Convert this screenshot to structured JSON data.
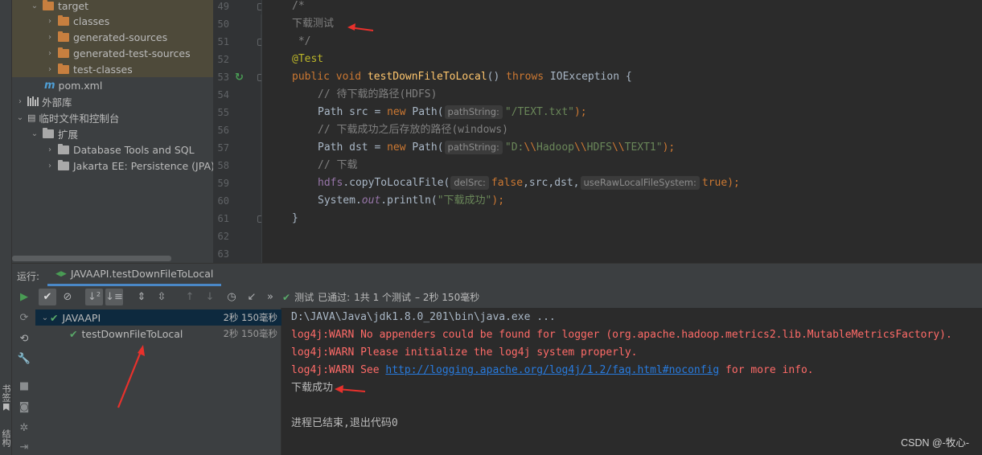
{
  "side_tabs": {
    "bookmarks": "书签",
    "structure": "结构"
  },
  "project_tree": [
    {
      "label": "target",
      "icon": "folder-orange",
      "chevron": "v"
    },
    {
      "label": "classes",
      "icon": "folder-orange",
      "chevron": ">"
    },
    {
      "label": "generated-sources",
      "icon": "folder-orange",
      "chevron": ">"
    },
    {
      "label": "generated-test-sources",
      "icon": "folder-orange",
      "chevron": ">"
    },
    {
      "label": "test-classes",
      "icon": "folder-orange",
      "chevron": ">"
    },
    {
      "label": "pom.xml",
      "icon": "maven-icon",
      "chevron": ""
    },
    {
      "label": "外部库",
      "icon": "library-icon",
      "chevron": ">"
    },
    {
      "label": "临时文件和控制台",
      "icon": "scratch-icon",
      "chevron": "v"
    },
    {
      "label": "扩展",
      "icon": "folder-grey",
      "chevron": "v"
    },
    {
      "label": "Database Tools and SQL",
      "icon": "folder-grey",
      "chevron": ">"
    },
    {
      "label": "Jakarta EE: Persistence (JPA)",
      "icon": "folder-grey",
      "chevron": ">"
    }
  ],
  "line_numbers": [
    "49",
    "50",
    "51",
    "52",
    "53",
    "54",
    "55",
    "56",
    "57",
    "58",
    "59",
    "60",
    "61",
    "62",
    "63"
  ],
  "code": {
    "l49": "/*",
    "l50": "下载测试",
    "l51": " */",
    "l52": "@Test",
    "l53_kw1": "public",
    "l53_kw2": "void",
    "l53_name": "testDownFileToLocal",
    "l53_paren": "() ",
    "l53_throws": "throws",
    "l53_exc": " IOException {",
    "l54": "// 待下载的路径(HDFS)",
    "l55_a": "Path src = ",
    "l55_new": "new",
    "l55_b": " Path(",
    "l55_hint": "pathString:",
    "l55_str": "\"/TEXT.txt\"",
    "l55_end": ");",
    "l56": "// 下载成功之后存放的路径(windows)",
    "l57_a": "Path dst = ",
    "l57_new": "new",
    "l57_b": " Path(",
    "l57_hint": "pathString:",
    "l57_str1": "\"D:",
    "l57_esc1": "\\\\",
    "l57_str2": "Hadoop",
    "l57_esc2": "\\\\",
    "l57_str3": "HDFS",
    "l57_esc3": "\\\\",
    "l57_str4": "TEXT1\"",
    "l57_end": ");",
    "l58": "// 下载",
    "l59_obj": "hdfs",
    "l59_call": ".copyToLocalFile(",
    "l59_hint1": "delSrc:",
    "l59_false": "false",
    "l59_mid": ",src,dst,",
    "l59_hint2": "useRawLocalFileSystem:",
    "l59_true": "true",
    "l59_end": ");",
    "l60_a": "System.",
    "l60_out": "out",
    "l60_b": ".println(",
    "l60_str": "\"下载成功\"",
    "l60_end": ");",
    "l61": "}"
  },
  "run_window": {
    "label": "运行:",
    "tab_title": "JAVAAPI.testDownFileToLocal",
    "status_test": "测试",
    "status_passed": "已通过:",
    "status_count": "1共 1 个测试",
    "status_time": "– 2秒 150毫秒"
  },
  "test_tree": [
    {
      "label": "JAVAAPI",
      "time": "2秒 150毫秒"
    },
    {
      "label": "testDownFileToLocal",
      "time": "2秒 150毫秒"
    }
  ],
  "console": {
    "line1": "D:\\JAVA\\Java\\jdk1.8.0_201\\bin\\java.exe ...",
    "line2": "log4j:WARN No appenders could be found for logger (org.apache.hadoop.metrics2.lib.MutableMetricsFactory).",
    "line3": "log4j:WARN Please initialize the log4j system properly.",
    "line4_a": "log4j:WARN See ",
    "line4_link": "http://logging.apache.org/log4j/1.2/faq.html#noconfig",
    "line4_b": " for more info.",
    "line5": "下载成功",
    "line6": "进程已结束,退出代码0"
  },
  "watermark": "CSDN @-牧心-",
  "colors": {
    "accent": "#4a88c7",
    "pass": "#59a869",
    "warn": "#ff6b68",
    "annotation_arrow": "#e8312c"
  }
}
